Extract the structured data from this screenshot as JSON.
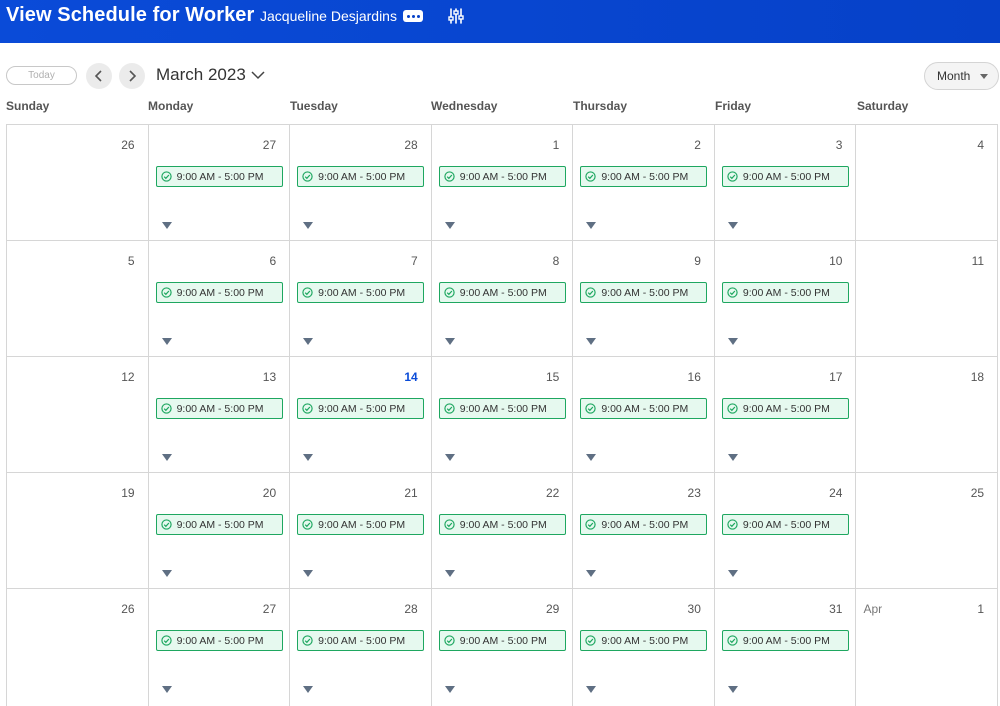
{
  "header": {
    "title": "View Schedule for Worker",
    "worker_name": "Jacqueline Desjardins"
  },
  "toolbar": {
    "today_label": "Today",
    "month_label": "March 2023",
    "view_label": "Month"
  },
  "days": [
    "Sunday",
    "Monday",
    "Tuesday",
    "Wednesday",
    "Thursday",
    "Friday",
    "Saturday"
  ],
  "shift_label": "9:00 AM - 5:00 PM",
  "today": "14",
  "weeks": [
    [
      {
        "d": "26"
      },
      {
        "d": "27",
        "shift": true
      },
      {
        "d": "28",
        "shift": true
      },
      {
        "d": "1",
        "shift": true
      },
      {
        "d": "2",
        "shift": true
      },
      {
        "d": "3",
        "shift": true
      },
      {
        "d": "4"
      }
    ],
    [
      {
        "d": "5"
      },
      {
        "d": "6",
        "shift": true
      },
      {
        "d": "7",
        "shift": true
      },
      {
        "d": "8",
        "shift": true
      },
      {
        "d": "9",
        "shift": true
      },
      {
        "d": "10",
        "shift": true
      },
      {
        "d": "11"
      }
    ],
    [
      {
        "d": "12"
      },
      {
        "d": "13",
        "shift": true
      },
      {
        "d": "14",
        "shift": true,
        "today": true
      },
      {
        "d": "15",
        "shift": true
      },
      {
        "d": "16",
        "shift": true
      },
      {
        "d": "17",
        "shift": true
      },
      {
        "d": "18"
      }
    ],
    [
      {
        "d": "19"
      },
      {
        "d": "20",
        "shift": true
      },
      {
        "d": "21",
        "shift": true
      },
      {
        "d": "22",
        "shift": true
      },
      {
        "d": "23",
        "shift": true
      },
      {
        "d": "24",
        "shift": true
      },
      {
        "d": "25"
      }
    ],
    [
      {
        "d": "26"
      },
      {
        "d": "27",
        "shift": true
      },
      {
        "d": "28",
        "shift": true
      },
      {
        "d": "29",
        "shift": true
      },
      {
        "d": "30",
        "shift": true
      },
      {
        "d": "31",
        "shift": true
      },
      {
        "d": "1",
        "prefix": "Apr"
      }
    ]
  ],
  "colors": {
    "header_bg": "#0641c8",
    "shift_border": "#1ea760",
    "shift_bg": "#e6f9ef",
    "today_text": "#0a4bd8"
  }
}
